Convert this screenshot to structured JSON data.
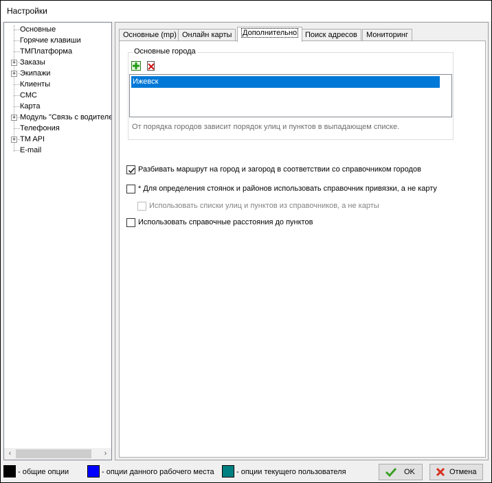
{
  "window": {
    "title": "Настройки"
  },
  "tree": {
    "items": [
      {
        "label": "Основные",
        "expandable": false
      },
      {
        "label": "Горячие клавиши",
        "expandable": false
      },
      {
        "label": "ТМПлатформа",
        "expandable": false
      },
      {
        "label": "Заказы",
        "expandable": true
      },
      {
        "label": "Экипажи",
        "expandable": true
      },
      {
        "label": "Клиенты",
        "expandable": false
      },
      {
        "label": "СМС",
        "expandable": false
      },
      {
        "label": "Карта",
        "expandable": false,
        "selected": true
      },
      {
        "label": "Модуль \"Связь с водителе",
        "expandable": true
      },
      {
        "label": "Телефония",
        "expandable": false
      },
      {
        "label": "TM API",
        "expandable": true
      },
      {
        "label": "E-mail",
        "expandable": false
      }
    ]
  },
  "tabs": [
    {
      "label": "Основные (mp)"
    },
    {
      "label": "Онлайн карты"
    },
    {
      "label": "Дополнительно",
      "active": true
    },
    {
      "label": "Поиск адресов"
    },
    {
      "label": "Мониторинг"
    }
  ],
  "cities_group": {
    "title": "Основные города",
    "items": [
      "Ижевск"
    ],
    "note": "От порядка городов зависит порядок улиц и пунктов в выпадающем списке."
  },
  "options": {
    "split_route": {
      "label": "Разбивать маршрут на город и загород в соответствии со справочником  городов",
      "checked": true
    },
    "use_binding_directory": {
      "label": "* Для определения стоянок и районов использовать справочник привязки, а не карту",
      "checked": false
    },
    "use_street_lists": {
      "label": "Использовать списки улиц и пунктов из справочников, а не карты",
      "checked": false,
      "disabled": true
    },
    "use_reference_distances": {
      "label": "Использовать справочные расстояния до пунктов",
      "checked": false
    }
  },
  "legend": [
    {
      "label": "- общие опции",
      "color": "#000000"
    },
    {
      "label": "- опции данного рабочего места",
      "color": "#0000ff"
    },
    {
      "label": "- опции текущего пользователя",
      "color": "#008080"
    }
  ],
  "buttons": {
    "ok": "OK",
    "cancel": "Отмена"
  },
  "icons": {
    "add": "add-icon",
    "delete": "delete-icon",
    "ok": "check-icon",
    "cancel": "cross-icon"
  }
}
